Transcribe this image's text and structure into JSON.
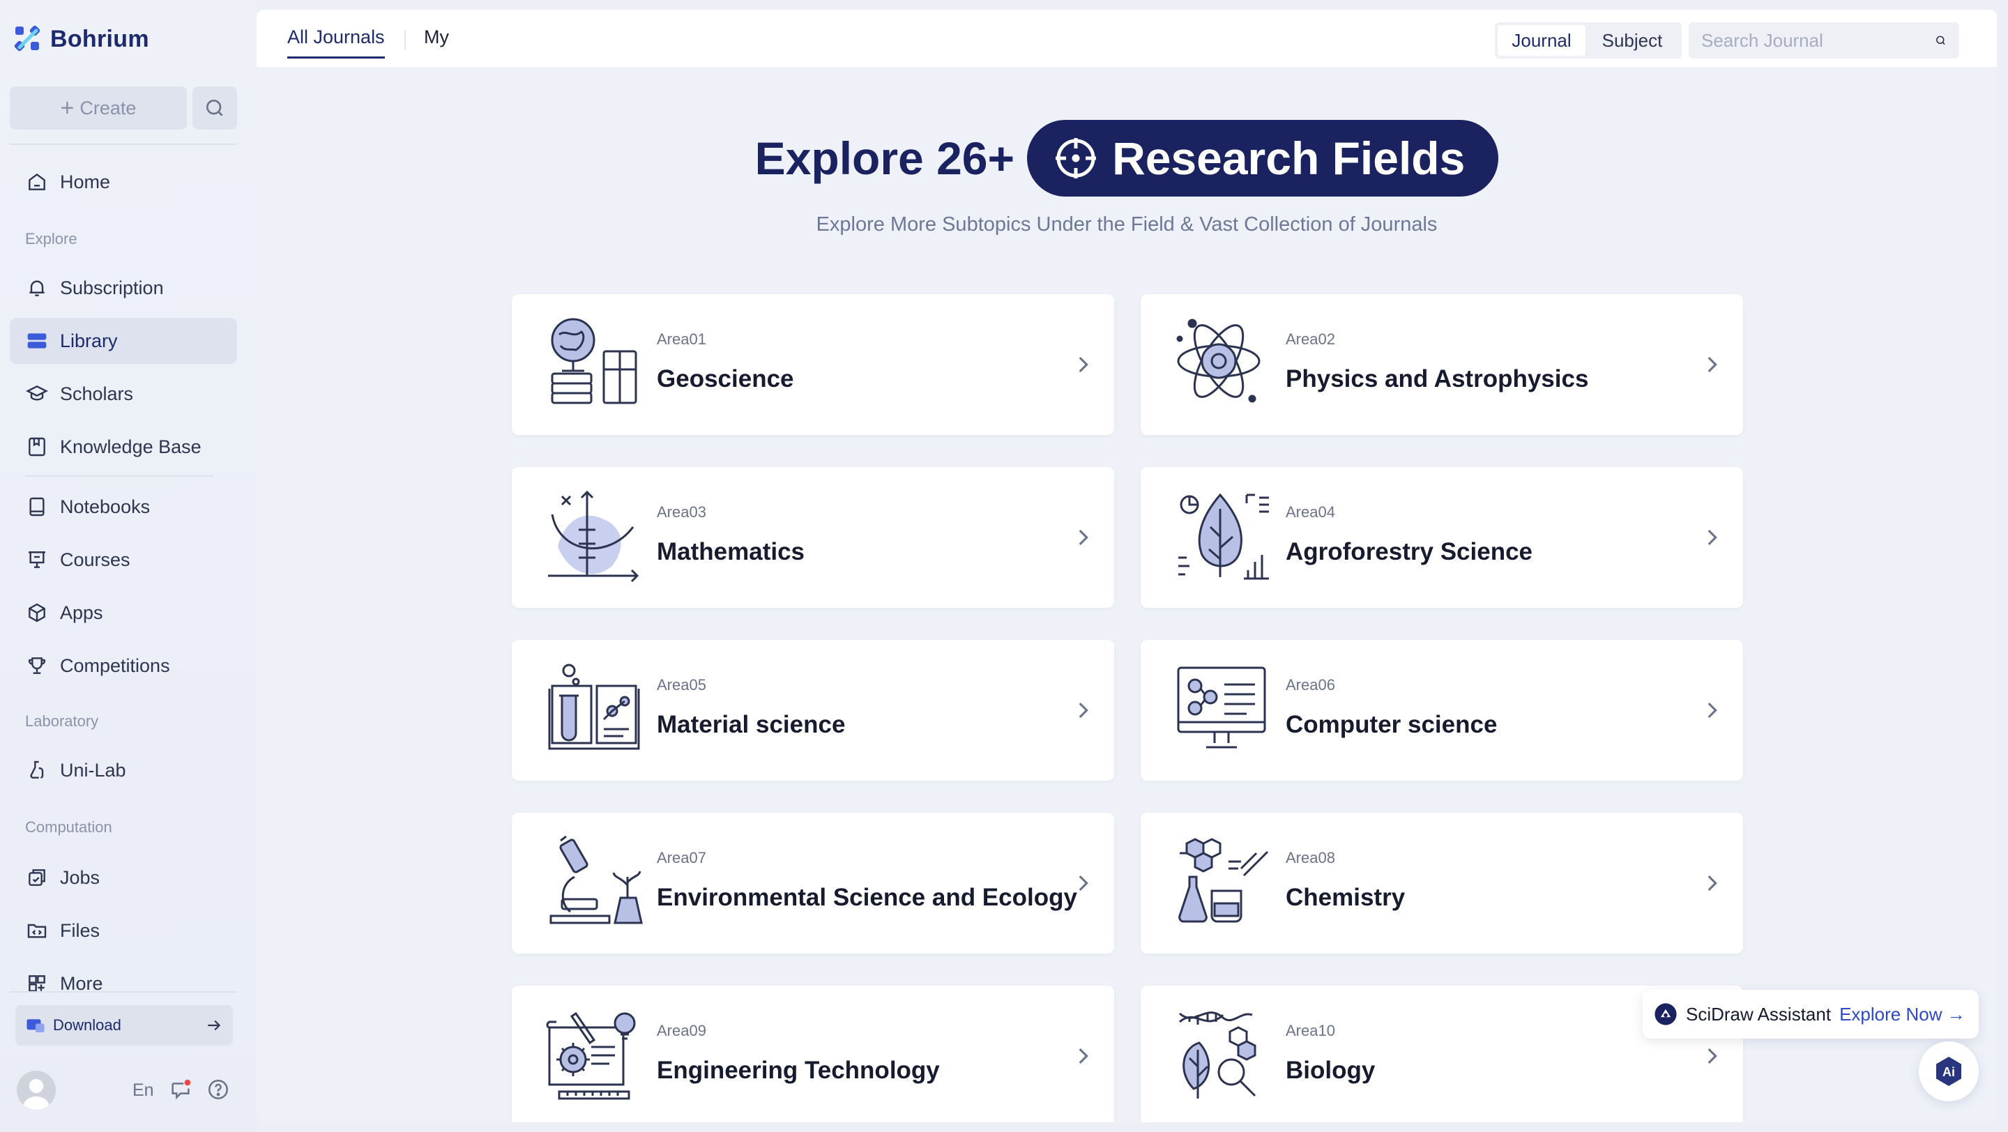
{
  "app": {
    "name": "Bohrium"
  },
  "sidebar": {
    "create_label": "Create",
    "items": [
      {
        "label": "Home",
        "icon": "home-icon"
      },
      {
        "label": "Subscription",
        "icon": "bell-icon"
      },
      {
        "label": "Library",
        "icon": "library-icon",
        "active": true
      },
      {
        "label": "Scholars",
        "icon": "graduation-cap-icon"
      },
      {
        "label": "Knowledge Base",
        "icon": "bookmark-book-icon"
      },
      {
        "label": "Notebooks",
        "icon": "notebook-icon"
      },
      {
        "label": "Courses",
        "icon": "presentation-board-icon"
      },
      {
        "label": "Apps",
        "icon": "cube-icon"
      },
      {
        "label": "Competitions",
        "icon": "trophy-icon"
      },
      {
        "label": "Uni-Lab",
        "icon": "flask-hand-icon"
      },
      {
        "label": "Jobs",
        "icon": "jobs-icon"
      },
      {
        "label": "Files",
        "icon": "folder-code-icon"
      },
      {
        "label": "More",
        "icon": "grid-icon"
      }
    ],
    "sections": {
      "explore": "Explore",
      "laboratory": "Laboratory",
      "computation": "Computation"
    },
    "download_label": "Download",
    "language": "En"
  },
  "topbar": {
    "tabs": [
      {
        "label": "All Journals",
        "active": true
      },
      {
        "label": "My"
      }
    ],
    "segment": [
      {
        "label": "Journal",
        "active": true
      },
      {
        "label": "Subject"
      }
    ],
    "search_placeholder": "Search Journal"
  },
  "hero": {
    "title_prefix": "Explore 26+",
    "title_highlight": "Research Fields",
    "subtitle": "Explore More Subtopics Under the Field & Vast Collection of Journals"
  },
  "areas": [
    {
      "code": "Area01",
      "name": "Geoscience",
      "icon": "globe-books-icon"
    },
    {
      "code": "Area02",
      "name": "Physics and Astrophysics",
      "icon": "atom-icon"
    },
    {
      "code": "Area03",
      "name": "Mathematics",
      "icon": "graph-axes-icon"
    },
    {
      "code": "Area04",
      "name": "Agroforestry Science",
      "icon": "leaf-chart-icon"
    },
    {
      "code": "Area05",
      "name": "Material science",
      "icon": "lab-book-icon"
    },
    {
      "code": "Area06",
      "name": "Computer science",
      "icon": "monitor-icon"
    },
    {
      "code": "Area07",
      "name": "Environmental Science and Ecology",
      "icon": "microscope-plant-icon"
    },
    {
      "code": "Area08",
      "name": "Chemistry",
      "icon": "molecule-flask-icon"
    },
    {
      "code": "Area09",
      "name": "Engineering Technology",
      "icon": "blueprint-gear-icon"
    },
    {
      "code": "Area10",
      "name": "Biology",
      "icon": "dna-leaf-icon"
    }
  ],
  "assistant": {
    "label": "SciDraw Assistant",
    "link": "Explore Now →",
    "ai_label": "Ai"
  },
  "colors": {
    "brand_navy": "#1a2360",
    "accent_blue": "#2f48c8",
    "illustration_fill": "#b9c0e6"
  }
}
